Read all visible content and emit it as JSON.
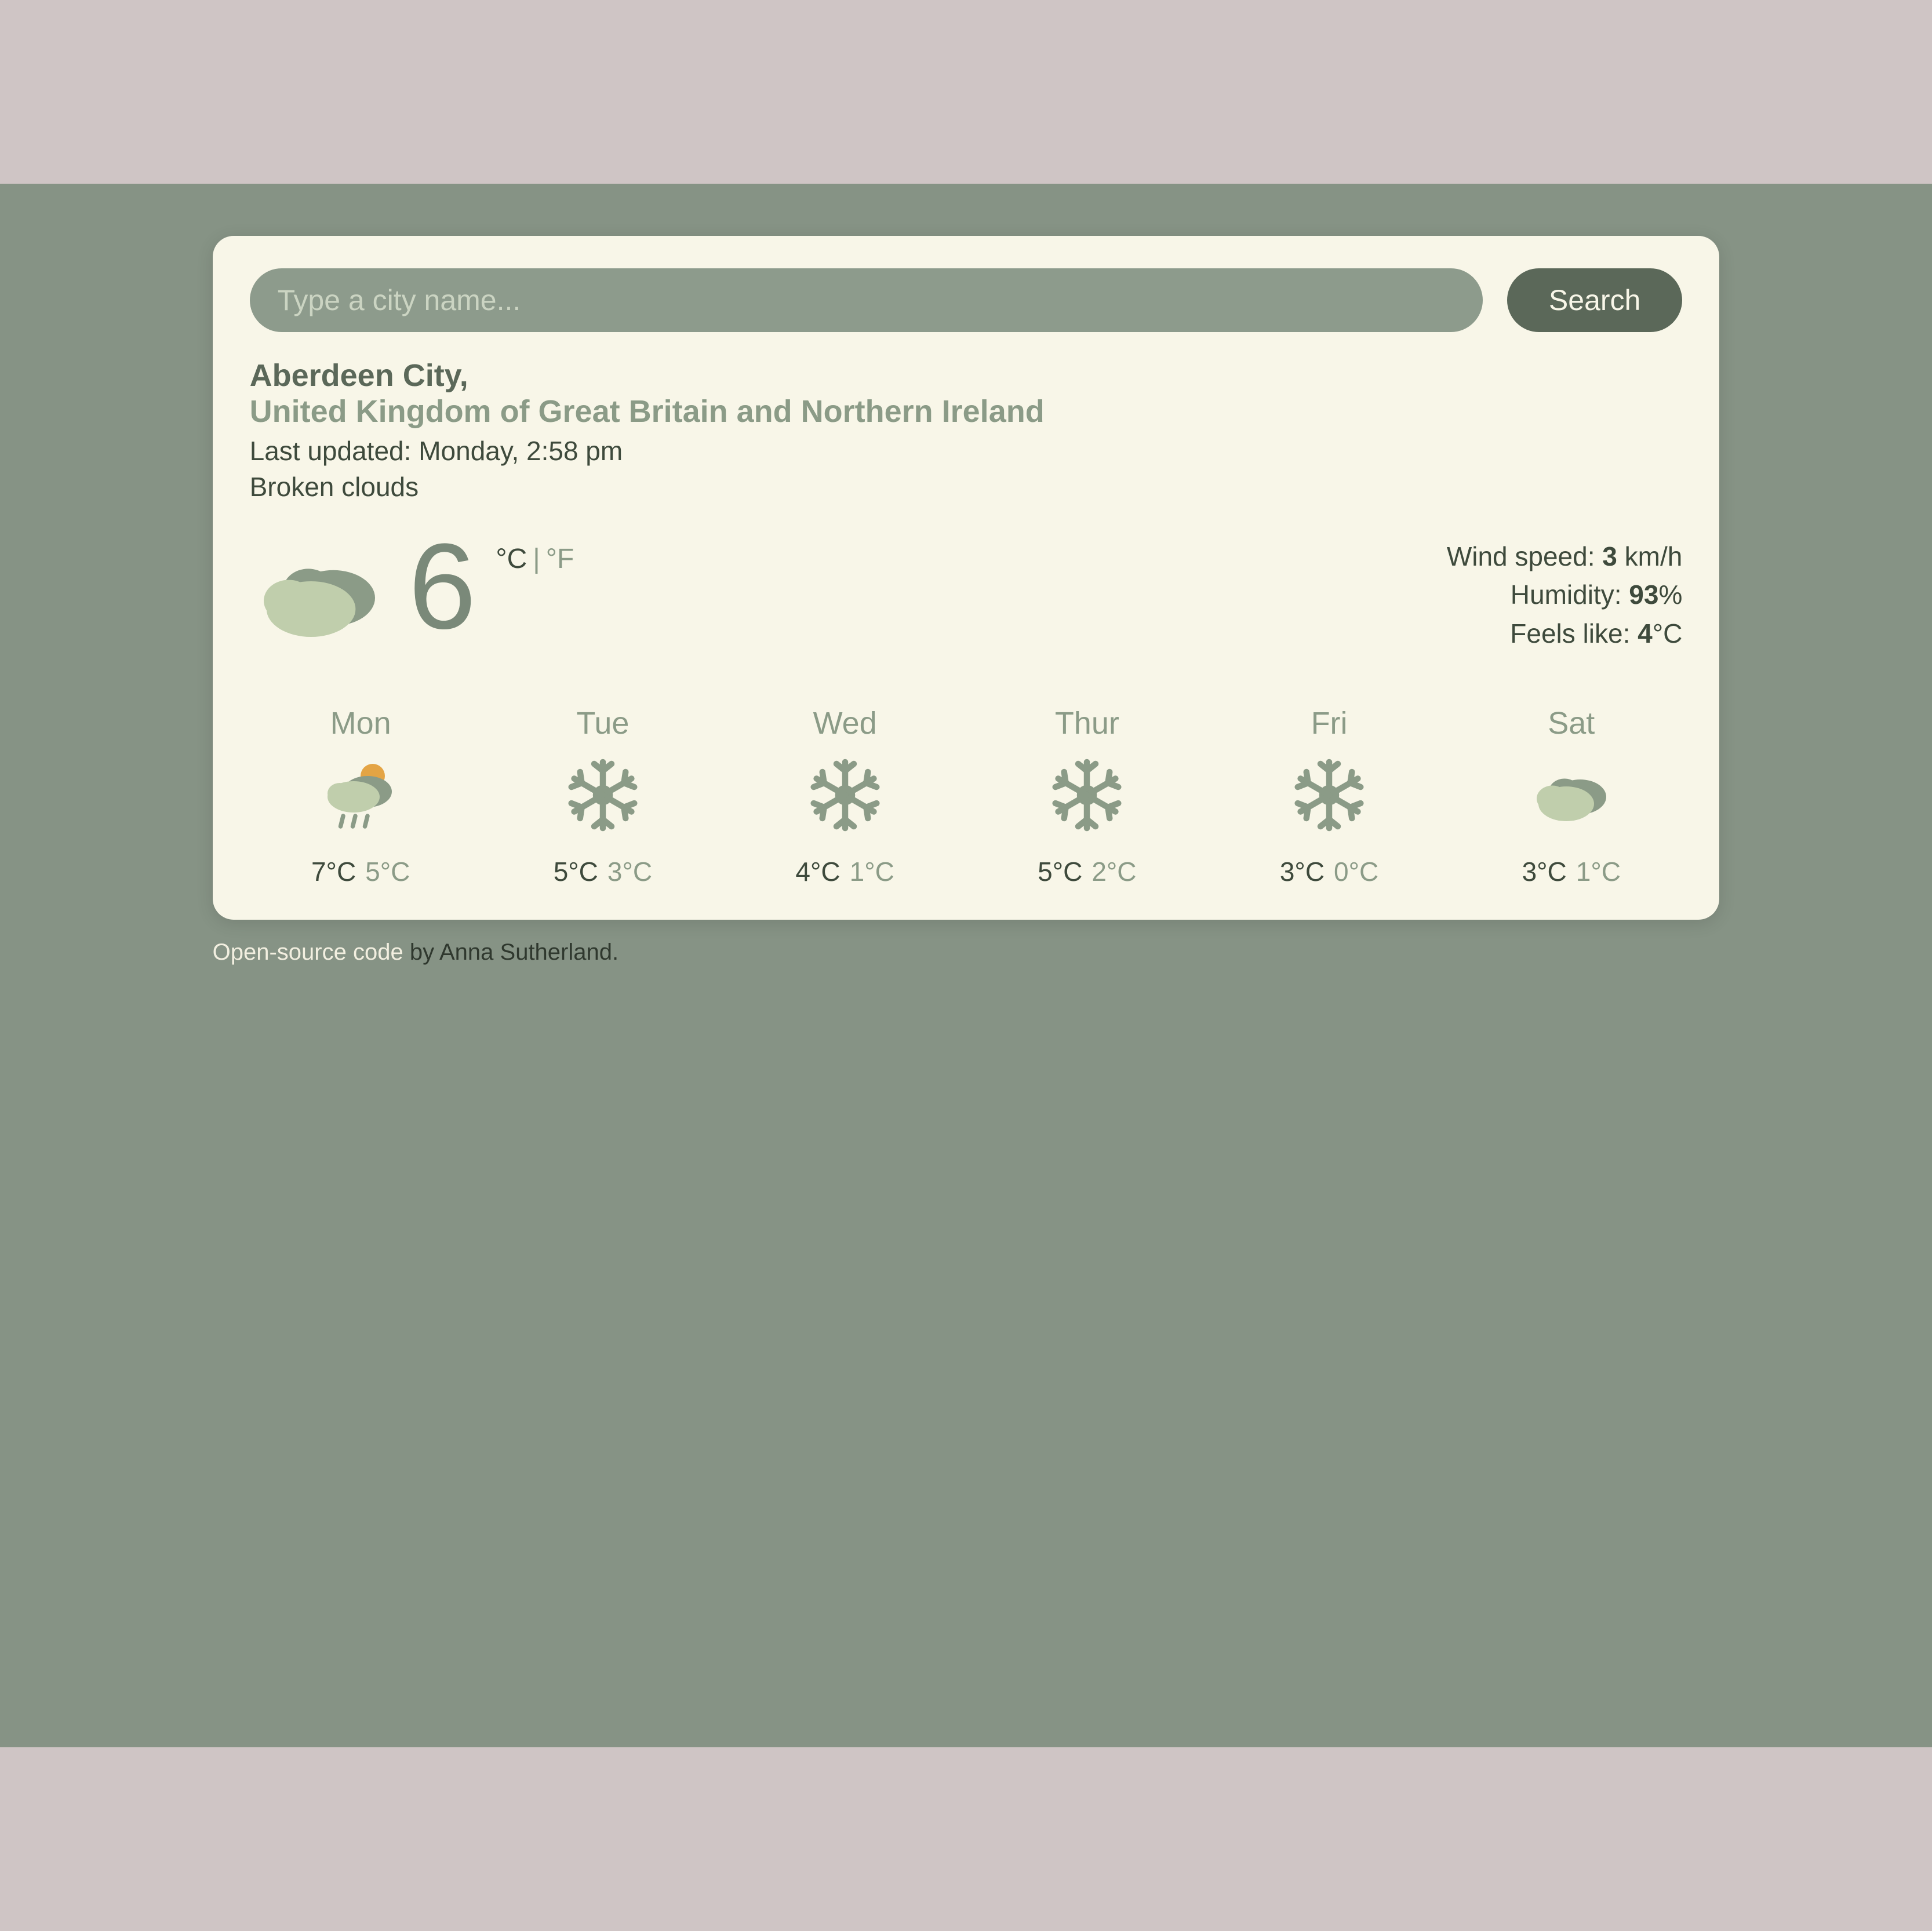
{
  "search": {
    "placeholder": "Type a city name...",
    "button_label": "Search"
  },
  "location": {
    "city": "Aberdeen City,",
    "country": "United Kingdom of Great Britain and Northern Ireland"
  },
  "meta": {
    "updated_prefix": "Last updated: ",
    "updated_value": "Monday, 2:58 pm",
    "condition": "Broken clouds"
  },
  "current": {
    "temp": "6",
    "unit_c": "°C",
    "unit_sep": " | ",
    "unit_f": "°F",
    "icon": "cloud"
  },
  "details": {
    "wind_label": "Wind speed: ",
    "wind_value": "3",
    "wind_unit": " km/h",
    "humidity_label": "Humidity: ",
    "humidity_value": "93",
    "humidity_unit": "%",
    "feels_label": "Feels like: ",
    "feels_value": "4",
    "feels_unit": "°C"
  },
  "forecast": [
    {
      "day": "Mon",
      "icon": "rain-sun",
      "hi": "7°C",
      "lo": "5°C"
    },
    {
      "day": "Tue",
      "icon": "snow",
      "hi": "5°C",
      "lo": "3°C"
    },
    {
      "day": "Wed",
      "icon": "snow",
      "hi": "4°C",
      "lo": "1°C"
    },
    {
      "day": "Thur",
      "icon": "snow",
      "hi": "5°C",
      "lo": "2°C"
    },
    {
      "day": "Fri",
      "icon": "snow",
      "hi": "3°C",
      "lo": "0°C"
    },
    {
      "day": "Sat",
      "icon": "cloud",
      "hi": "3°C",
      "lo": "1°C"
    }
  ],
  "footer": {
    "link_text": "Open-source code",
    "rest": " by Anna Sutherland."
  }
}
